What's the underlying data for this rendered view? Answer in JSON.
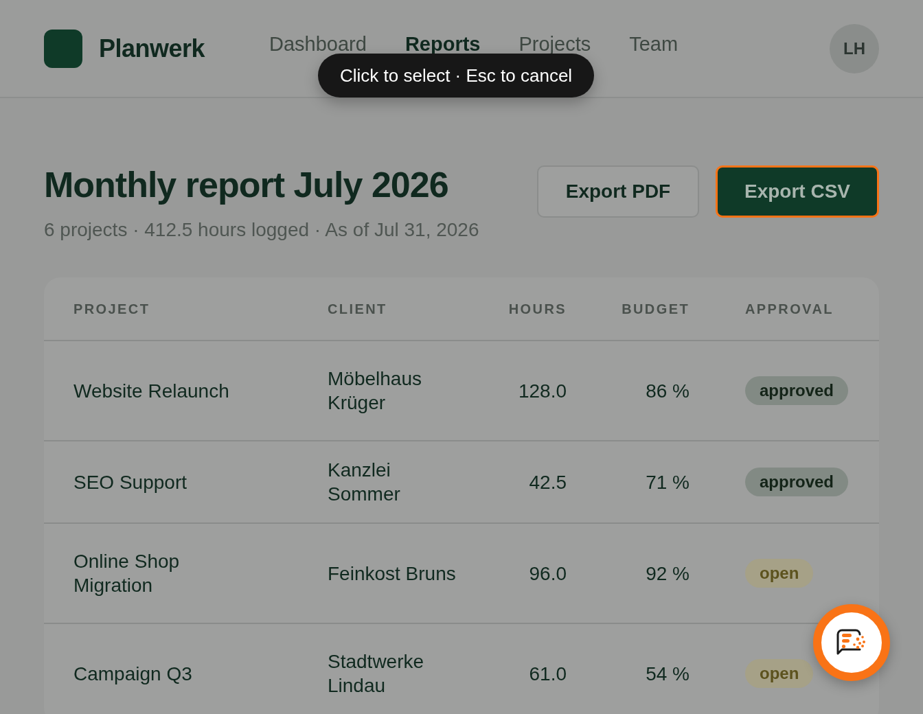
{
  "brand": {
    "name": "Planwerk"
  },
  "nav": [
    {
      "label": "Dashboard",
      "selected": false
    },
    {
      "label": "Reports",
      "selected": true
    },
    {
      "label": "Projects",
      "selected": false
    },
    {
      "label": "Team",
      "selected": false
    }
  ],
  "avatar": {
    "initials": "LH"
  },
  "tooltip": {
    "text": "Click to select · Esc to cancel"
  },
  "report": {
    "title": "Monthly report July 2026",
    "subtitle": "6 projects · 412.5 hours logged · As of Jul 31, 2026"
  },
  "buttons": [
    {
      "label": "Export PDF",
      "kind": "outline",
      "highlighted": false
    },
    {
      "label": "Export CSV",
      "kind": "primary",
      "highlighted": true
    }
  ],
  "table": {
    "columns": [
      "PROJECT",
      "CLIENT",
      "HOURS",
      "BUDGET",
      "APPROVAL"
    ],
    "rows": [
      {
        "project": "Website Relaunch",
        "client": "Möbelhaus Krüger",
        "hours": "128.0",
        "budget": "86 %",
        "approval": "approved",
        "color": "#828a84"
      },
      {
        "project": "SEO Support",
        "client": "Kanzlei Sommer",
        "hours": "42.5",
        "budget": "71 %",
        "approval": "approved",
        "color": "#828a84"
      },
      {
        "project": "Online Shop Migration",
        "client": "Feinkost Bruns",
        "hours": "96.0",
        "budget": "92 %",
        "approval": "open",
        "color": "#a6a187"
      },
      {
        "project": "Campaign Q3",
        "client": "Stadtwerke Lindau",
        "hours": "61.0",
        "budget": "54 %",
        "approval": "open",
        "color": "#a6a187"
      }
    ]
  }
}
